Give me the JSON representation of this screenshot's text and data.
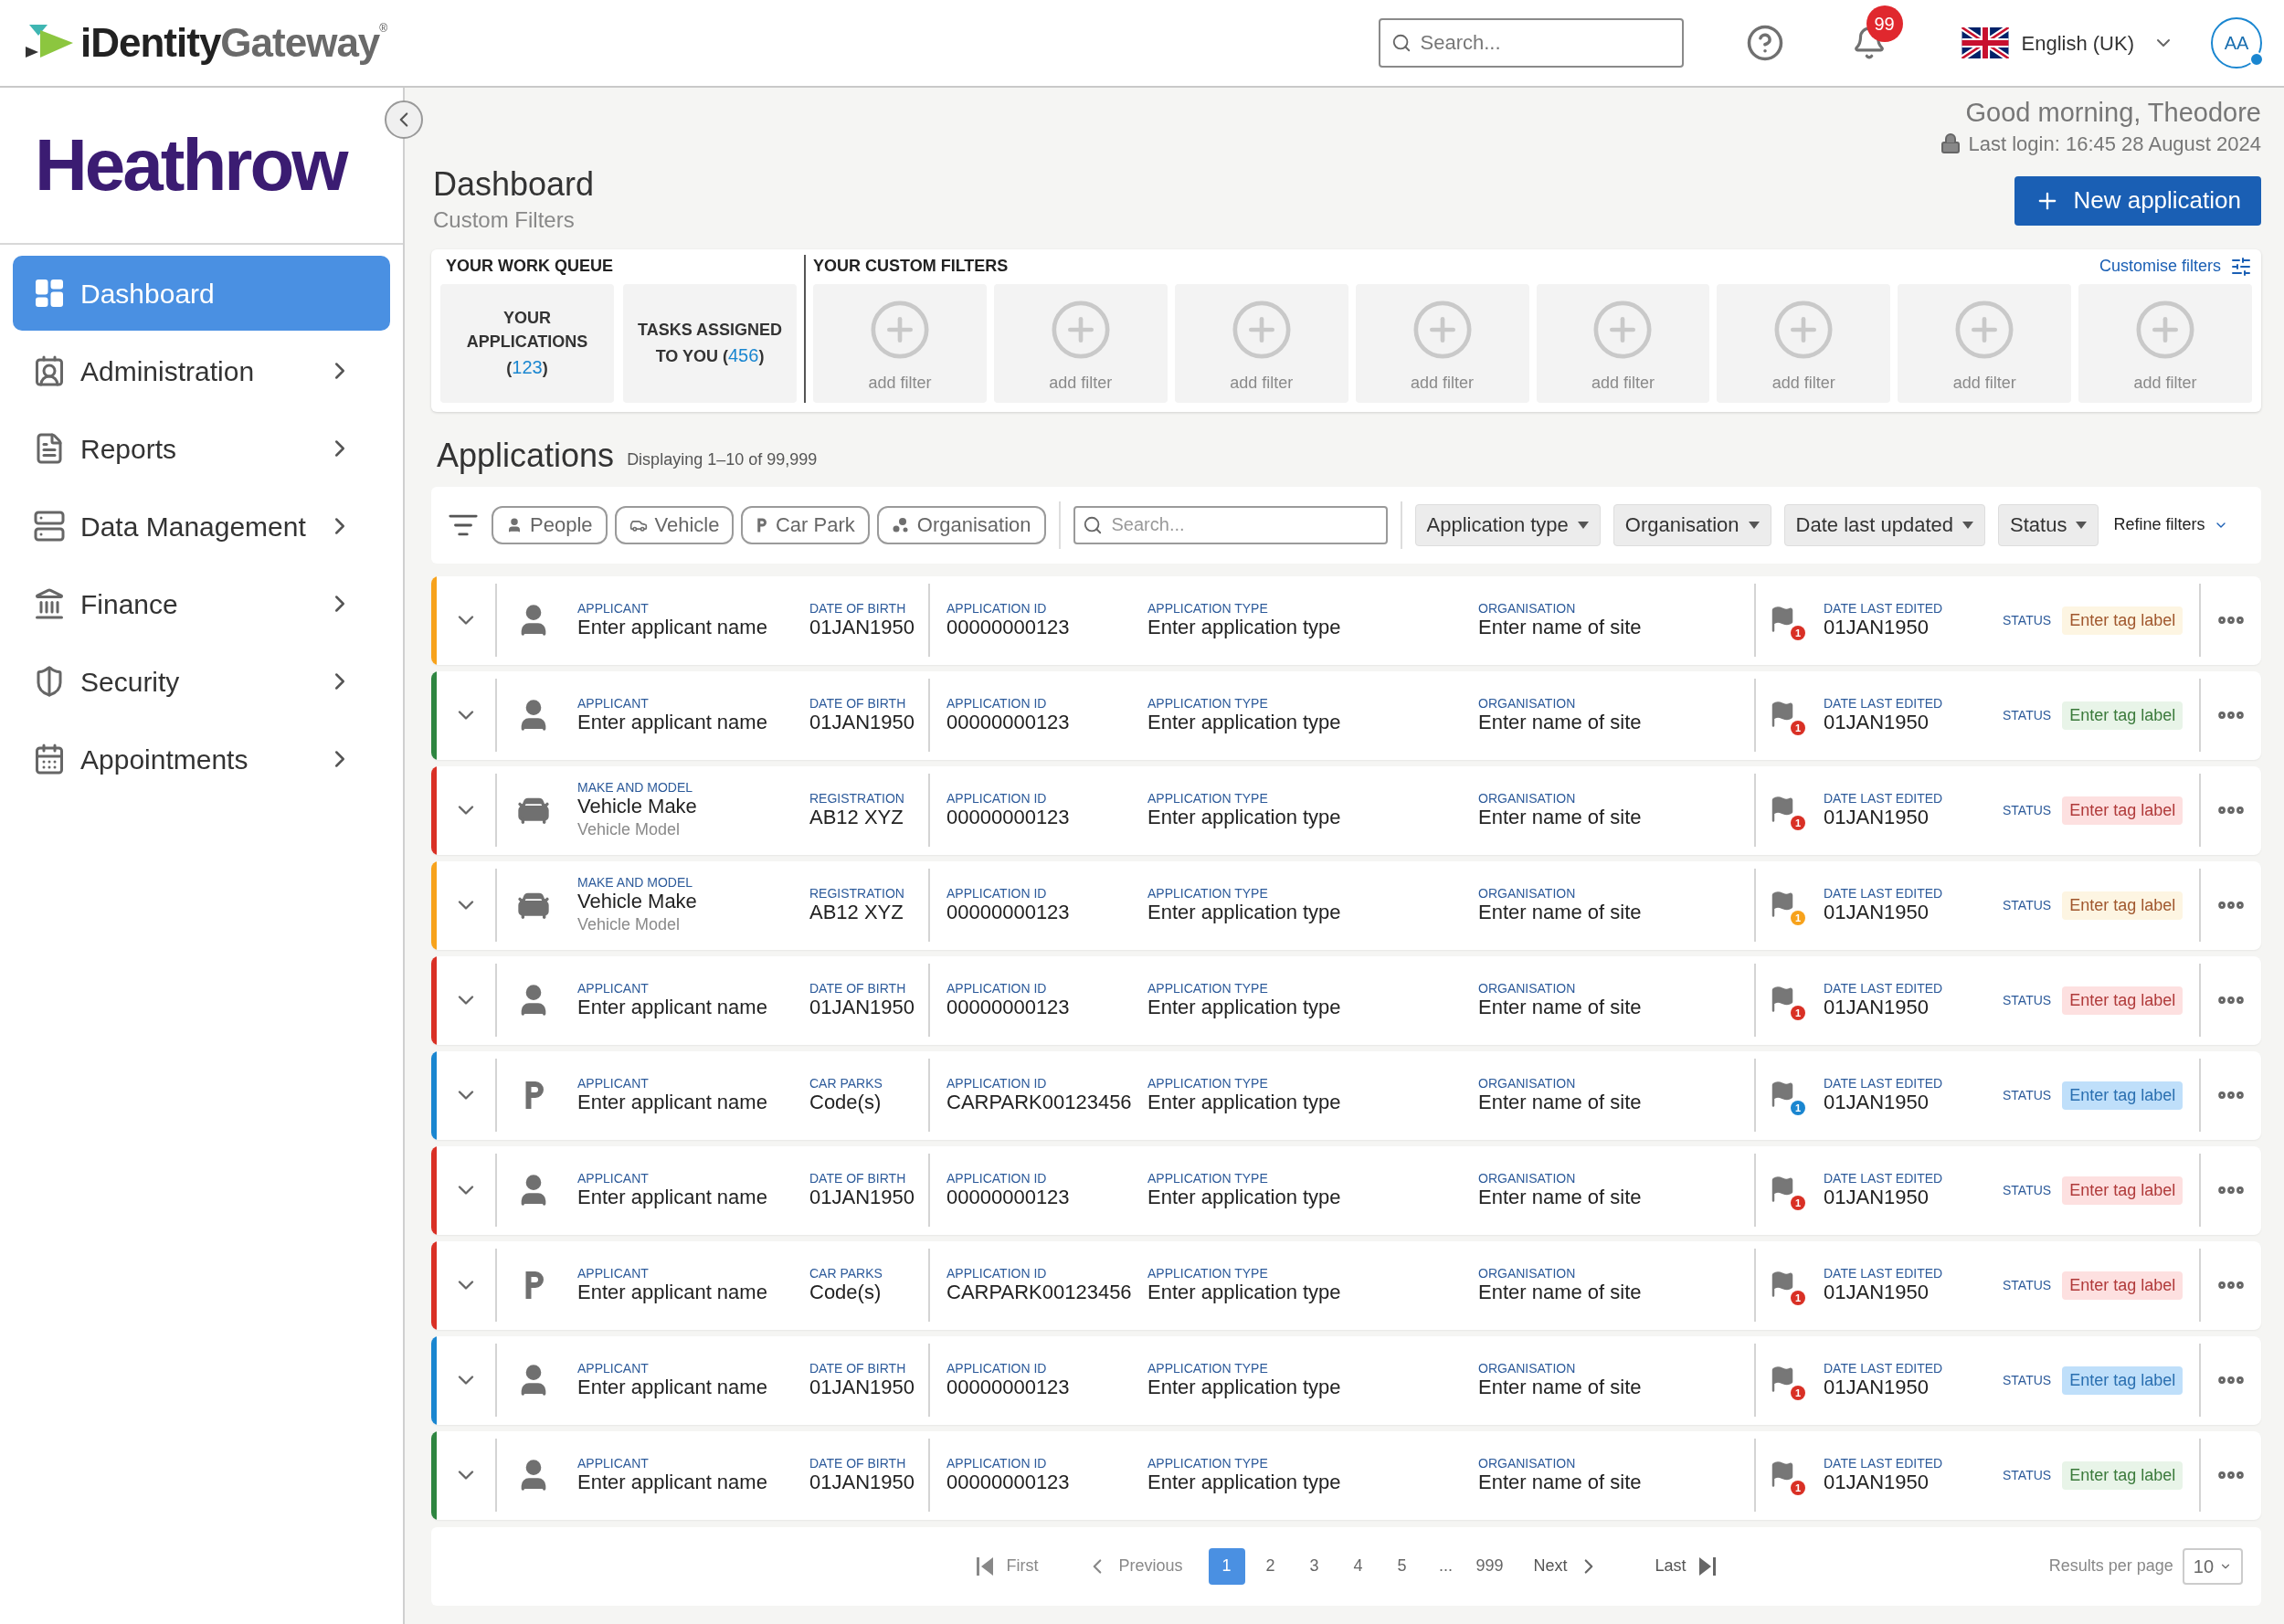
{
  "header": {
    "logo": {
      "part_a": "iDentity",
      "part_b": "Gateway",
      "mark": "®"
    },
    "search": {
      "placeholder": "Search..."
    },
    "notifications": {
      "count": "99"
    },
    "language": "English (UK)",
    "avatar": "AA"
  },
  "sidebar": {
    "logo": "Heathrow",
    "items": [
      {
        "kind": "dashboard",
        "label": "Dashboard",
        "selected": true,
        "has_submenu": false
      },
      {
        "kind": "administration",
        "label": "Administration",
        "selected": false,
        "has_submenu": true
      },
      {
        "kind": "reports",
        "label": "Reports",
        "selected": false,
        "has_submenu": true
      },
      {
        "kind": "data",
        "label": "Data Management",
        "selected": false,
        "has_submenu": true
      },
      {
        "kind": "finance",
        "label": "Finance",
        "selected": false,
        "has_submenu": true
      },
      {
        "kind": "security",
        "label": "Security",
        "selected": false,
        "has_submenu": true
      },
      {
        "kind": "appointments",
        "label": "Appointments",
        "selected": false,
        "has_submenu": true
      }
    ]
  },
  "greeting": "Good morning, Theodore",
  "last_login": "Last login: 16:45 28 August 2024",
  "page": {
    "title": "Dashboard",
    "subtitle": "Custom Filters",
    "new_button": "New application"
  },
  "work_queue": {
    "title": "YOUR WORK QUEUE",
    "tiles": [
      {
        "label": "YOUR APPLICATIONS",
        "open": "(",
        "count": "123",
        "close": ")"
      },
      {
        "label": "TASKS ASSIGNED TO YOU",
        "open": "(",
        "count": "456",
        "close": ")"
      }
    ]
  },
  "custom_filters": {
    "title": "YOUR CUSTOM FILTERS",
    "link": "Customise filters",
    "tiles": [
      "add filter",
      "add filter",
      "add filter",
      "add filter",
      "add filter",
      "add filter",
      "add filter",
      "add filter"
    ]
  },
  "applications": {
    "title": "Applications",
    "summary": "Displaying 1–10 of 99,999"
  },
  "toolbar": {
    "chips": [
      {
        "kind": "person",
        "label": "People"
      },
      {
        "kind": "vehicle",
        "label": "Vehicle"
      },
      {
        "kind": "carpark",
        "label": "Car Park"
      },
      {
        "kind": "organisation",
        "label": "Organisation"
      }
    ],
    "search": {
      "placeholder": "Search..."
    },
    "dropdowns": [
      "Application type",
      "Organisation",
      "Date last updated",
      "Status"
    ],
    "refine": "Refine filters"
  },
  "rows": [
    {
      "kind": "person",
      "color": "#f7a21b",
      "primary_label": "APPLICANT",
      "primary": "Enter applicant name",
      "secondary_label": "DATE OF BIRTH",
      "secondary": "01JAN1950",
      "id_label": "APPLICATION ID",
      "id": "00000000123",
      "type_label": "APPLICATION TYPE",
      "type": "Enter application type",
      "org_label": "ORGANISATION",
      "org": "Enter name of site",
      "flag": {
        "count": "1",
        "color": "#d93025"
      },
      "date_label": "DATE LAST EDITED",
      "date": "01JAN1950",
      "status_label": "STATUS",
      "tag": {
        "text": "Enter tag label",
        "color": "#a0572d"
      }
    },
    {
      "kind": "person",
      "color": "#2e8540",
      "primary_label": "APPLICANT",
      "primary": "Enter applicant name",
      "secondary_label": "DATE OF BIRTH",
      "secondary": "01JAN1950",
      "id_label": "APPLICATION ID",
      "id": "00000000123",
      "type_label": "APPLICATION TYPE",
      "type": "Enter application type",
      "org_label": "ORGANISATION",
      "org": "Enter name of site",
      "flag": {
        "count": "1",
        "color": "#d93025"
      },
      "date_label": "DATE LAST EDITED",
      "date": "01JAN1950",
      "status_label": "STATUS",
      "tag": {
        "text": "Enter tag label",
        "color": "#3b7a3b"
      }
    },
    {
      "kind": "vehicle",
      "color": "#d93025",
      "primary_label": "MAKE AND MODEL",
      "primary": "Vehicle Make",
      "sub": "Vehicle Model",
      "secondary_label": "REGISTRATION",
      "secondary": "AB12 XYZ",
      "id_label": "APPLICATION ID",
      "id": "00000000123",
      "type_label": "APPLICATION TYPE",
      "type": "Enter application type",
      "org_label": "ORGANISATION",
      "org": "Enter name of site",
      "flag": {
        "count": "1",
        "color": "#d93025"
      },
      "date_label": "DATE LAST EDITED",
      "date": "01JAN1950",
      "status_label": "STATUS",
      "tag": {
        "text": "Enter tag label",
        "color": "#b03a3a"
      }
    },
    {
      "kind": "vehicle",
      "color": "#f7a21b",
      "primary_label": "MAKE AND MODEL",
      "primary": "Vehicle Make",
      "sub": "Vehicle Model",
      "secondary_label": "REGISTRATION",
      "secondary": "AB12 XYZ",
      "id_label": "APPLICATION ID",
      "id": "00000000123",
      "type_label": "APPLICATION TYPE",
      "type": "Enter application type",
      "org_label": "ORGANISATION",
      "org": "Enter name of site",
      "flag": {
        "count": "1",
        "color": "#f7a21b"
      },
      "date_label": "DATE LAST EDITED",
      "date": "01JAN1950",
      "status_label": "STATUS",
      "tag": {
        "text": "Enter tag label",
        "color": "#a0572d"
      }
    },
    {
      "kind": "person",
      "color": "#d93025",
      "primary_label": "APPLICANT",
      "primary": "Enter applicant name",
      "secondary_label": "DATE OF BIRTH",
      "secondary": "01JAN1950",
      "id_label": "APPLICATION ID",
      "id": "00000000123",
      "type_label": "APPLICATION TYPE",
      "type": "Enter application type",
      "org_label": "ORGANISATION",
      "org": "Enter name of site",
      "flag": {
        "count": "1",
        "color": "#d93025"
      },
      "date_label": "DATE LAST EDITED",
      "date": "01JAN1950",
      "status_label": "STATUS",
      "tag": {
        "text": "Enter tag label",
        "color": "#b03a3a"
      }
    },
    {
      "kind": "carpark",
      "color": "#1a86d0",
      "primary_label": "APPLICANT",
      "primary": "Enter applicant name",
      "secondary_label": "CAR PARKS",
      "secondary": "Code(s)",
      "id_label": "APPLICATION ID",
      "id": "CARPARK00123456",
      "type_label": "APPLICATION TYPE",
      "type": "Enter application type",
      "org_label": "ORGANISATION",
      "org": "Enter name of site",
      "flag": {
        "count": "1",
        "color": "#1a86d0"
      },
      "date_label": "DATE LAST EDITED",
      "date": "01JAN1950",
      "status_label": "STATUS",
      "tag": {
        "text": "Enter tag label",
        "color": "#2a6fb0"
      }
    },
    {
      "kind": "person",
      "color": "#d93025",
      "primary_label": "APPLICANT",
      "primary": "Enter applicant name",
      "secondary_label": "DATE OF BIRTH",
      "secondary": "01JAN1950",
      "id_label": "APPLICATION ID",
      "id": "00000000123",
      "type_label": "APPLICATION TYPE",
      "type": "Enter application type",
      "org_label": "ORGANISATION",
      "org": "Enter name of site",
      "flag": {
        "count": "1",
        "color": "#d93025"
      },
      "date_label": "DATE LAST EDITED",
      "date": "01JAN1950",
      "status_label": "STATUS",
      "tag": {
        "text": "Enter tag label",
        "color": "#b03a3a"
      }
    },
    {
      "kind": "carpark",
      "color": "#d93025",
      "primary_label": "APPLICANT",
      "primary": "Enter applicant name",
      "secondary_label": "CAR PARKS",
      "secondary": "Code(s)",
      "id_label": "APPLICATION ID",
      "id": "CARPARK00123456",
      "type_label": "APPLICATION TYPE",
      "type": "Enter application type",
      "org_label": "ORGANISATION",
      "org": "Enter name of site",
      "flag": {
        "count": "1",
        "color": "#d93025"
      },
      "date_label": "DATE LAST EDITED",
      "date": "01JAN1950",
      "status_label": "STATUS",
      "tag": {
        "text": "Enter tag label",
        "color": "#b03a3a"
      }
    },
    {
      "kind": "person",
      "color": "#1a86d0",
      "primary_label": "APPLICANT",
      "primary": "Enter applicant name",
      "secondary_label": "DATE OF BIRTH",
      "secondary": "01JAN1950",
      "id_label": "APPLICATION ID",
      "id": "00000000123",
      "type_label": "APPLICATION TYPE",
      "type": "Enter application type",
      "org_label": "ORGANISATION",
      "org": "Enter name of site",
      "flag": {
        "count": "1",
        "color": "#d93025"
      },
      "date_label": "DATE LAST EDITED",
      "date": "01JAN1950",
      "status_label": "STATUS",
      "tag": {
        "text": "Enter tag label",
        "color": "#2a6fb0"
      }
    },
    {
      "kind": "person",
      "color": "#2e8540",
      "primary_label": "APPLICANT",
      "primary": "Enter applicant name",
      "secondary_label": "DATE OF BIRTH",
      "secondary": "01JAN1950",
      "id_label": "APPLICATION ID",
      "id": "00000000123",
      "type_label": "APPLICATION TYPE",
      "type": "Enter application type",
      "org_label": "ORGANISATION",
      "org": "Enter name of site",
      "flag": {
        "count": "1",
        "color": "#d93025"
      },
      "date_label": "DATE LAST EDITED",
      "date": "01JAN1950",
      "status_label": "STATUS",
      "tag": {
        "text": "Enter tag label",
        "color": "#3b7a3b"
      }
    }
  ],
  "pagination": {
    "first": "First",
    "previous": "Previous",
    "pages": [
      {
        "label": "1",
        "selected": true
      },
      {
        "label": "2",
        "selected": false
      },
      {
        "label": "3",
        "selected": false
      },
      {
        "label": "4",
        "selected": false
      },
      {
        "label": "5",
        "selected": false
      },
      {
        "label": "...",
        "selected": false
      },
      {
        "label": "999",
        "selected": false
      }
    ],
    "next": "Next",
    "last": "Last",
    "per_page_label": "Results per page",
    "per_page": "10"
  }
}
